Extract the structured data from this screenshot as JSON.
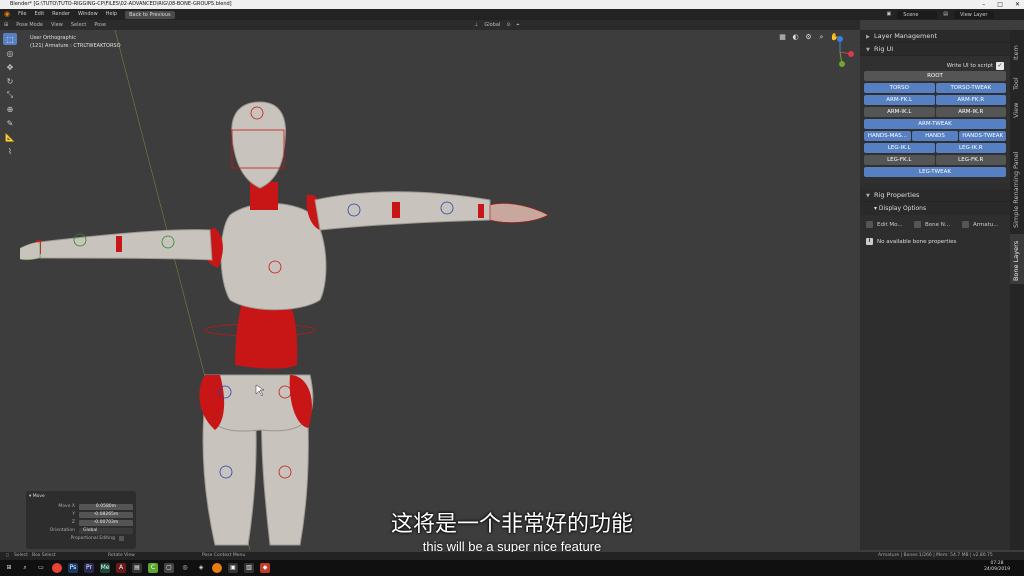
{
  "window": {
    "title": "Blender* [G:\\TUTO\\TUTO-RIGGING-CP\\FILES\\02-ADVANCED\\RIG\\08-BONE-GROUPS.blend]",
    "controls": [
      "–",
      "□",
      "✕"
    ]
  },
  "menubar": {
    "items": [
      "File",
      "Edit",
      "Render",
      "Window",
      "Help"
    ],
    "back_button": "Back to Previous",
    "scene_label": "Scene",
    "view_layer_label": "View Layer"
  },
  "viewport_header": {
    "mode": "Pose Mode",
    "menus": [
      "View",
      "Select",
      "Pose"
    ],
    "orientation": "Global"
  },
  "viewport_info": {
    "view": "User Orthographic",
    "object": "(121) Armature : CTRLTWEAKTORSO"
  },
  "toolbar": {
    "tools": [
      "select-box",
      "cursor",
      "move",
      "rotate",
      "scale",
      "transform",
      "annotate",
      "measure",
      "pose"
    ]
  },
  "nav": {
    "icons": [
      "toggle-xray",
      "viewport-shading",
      "overlays",
      "zoom",
      "pan"
    ]
  },
  "operator_panel": {
    "title": "Move",
    "rows": [
      {
        "label": "Move X",
        "value": "0.0580m"
      },
      {
        "label": "Y",
        "value": "-0.08265m"
      },
      {
        "label": "Z",
        "value": "-0.00703m"
      }
    ],
    "orientation_label": "Orientation",
    "orientation_value": "Global",
    "proportional_label": "Proportional Editing"
  },
  "npanel": {
    "layer_management": "Layer Management",
    "rig_ui": "Rig UI",
    "write_ui": "Write UI to script",
    "button_rows": [
      [
        {
          "label": "ROOT",
          "on": false
        }
      ],
      [
        {
          "label": "TORSO",
          "on": true
        },
        {
          "label": "TORSO-TWEAK",
          "on": true
        }
      ],
      [
        {
          "label": "ARM-FK.L",
          "on": true
        },
        {
          "label": "ARM-FK.R",
          "on": true
        }
      ],
      [
        {
          "label": "ARM-IK.L",
          "on": false
        },
        {
          "label": "ARM-IK.R",
          "on": false
        }
      ],
      [
        {
          "label": "ARM-TWEAK",
          "on": true
        }
      ],
      [
        {
          "label": "HANDS-MAS...",
          "on": true
        },
        {
          "label": "HANDS",
          "on": true
        },
        {
          "label": "HANDS-TWEAK",
          "on": true
        }
      ],
      [
        {
          "label": "LEG-IK.L",
          "on": true
        },
        {
          "label": "LEG-IK.R",
          "on": true
        }
      ],
      [
        {
          "label": "LEG-FK.L",
          "on": false
        },
        {
          "label": "LEG-FK.R",
          "on": false
        }
      ],
      [
        {
          "label": "LEG-TWEAK",
          "on": true
        }
      ]
    ],
    "rig_properties": "Rig Properties",
    "display_options": "Display Options",
    "options": [
      "Edit Mo...",
      "Bone N...",
      "Armatu..."
    ],
    "no_props": "No available bone properties"
  },
  "vtabs": [
    "Item",
    "Tool",
    "View",
    "Simple Renaming Panel",
    "Bone Layers"
  ],
  "subtitles": {
    "cn": "这将是一个非常好的功能",
    "en": "this will be a super nice feature"
  },
  "statusbar": {
    "select": "Select",
    "box_select": "Box Select",
    "rotate_view": "Rotate View",
    "context_menu": "Pose Context Menu",
    "stats": "Armature | Bones:1/266 | Mem: 54.7 MB | v2.80.75"
  },
  "taskbar": {
    "time": "07:28",
    "date": "24/09/2019"
  },
  "colors": {
    "accent": "#5680c2",
    "body": "#c8c3bc",
    "tweak": "#c81616"
  }
}
